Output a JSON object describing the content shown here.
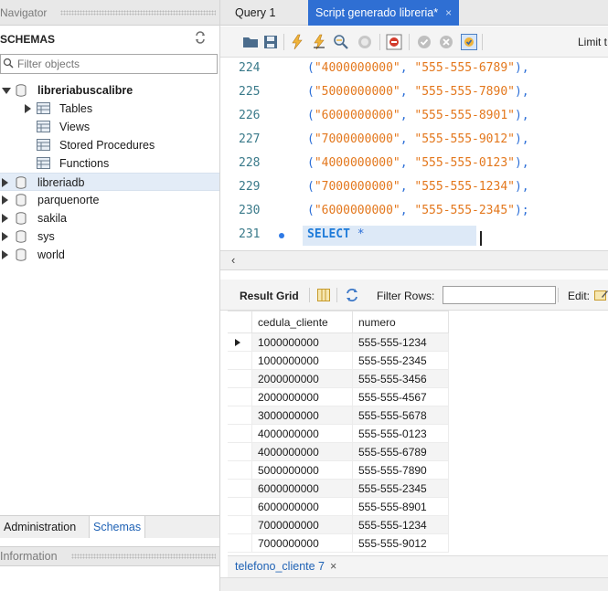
{
  "navigator": {
    "title": "Navigator",
    "schemas_label": "SCHEMAS",
    "filter_placeholder": "Filter objects",
    "tree": [
      {
        "label": "libreriabuscalibre",
        "expanded": true,
        "bold": true
      },
      {
        "label": "Tables"
      },
      {
        "label": "Views"
      },
      {
        "label": "Stored Procedures"
      },
      {
        "label": "Functions"
      },
      {
        "label": "libreriadb",
        "selected": true
      },
      {
        "label": "parquenorte"
      },
      {
        "label": "sakila"
      },
      {
        "label": "sys"
      },
      {
        "label": "world"
      }
    ],
    "bottom_tabs": [
      "Administration",
      "Schemas"
    ],
    "information_label": "Information"
  },
  "tabs": [
    {
      "label": "Query 1"
    },
    {
      "label": "Script generado libreria*",
      "active": true,
      "close": "×"
    }
  ],
  "toolbar": {
    "limit_label": "Limit t",
    "icons": [
      "open-folder-icon",
      "save-icon",
      "execute-icon",
      "execute-current-icon",
      "explain-icon",
      "stop-icon",
      "toggle-error-icon",
      "commit-icon",
      "rollback-icon",
      "autocommit-icon"
    ]
  },
  "editor": {
    "lines": [
      {
        "num": "224",
        "cedula": "\"4000000000\"",
        "numero": "\"555-555-6789\"",
        "end": "),"
      },
      {
        "num": "225",
        "cedula": "\"5000000000\"",
        "numero": "\"555-555-7890\"",
        "end": "),"
      },
      {
        "num": "226",
        "cedula": "\"6000000000\"",
        "numero": "\"555-555-8901\"",
        "end": "),"
      },
      {
        "num": "227",
        "cedula": "\"7000000000\"",
        "numero": "\"555-555-9012\"",
        "end": "),"
      },
      {
        "num": "228",
        "cedula": "\"4000000000\"",
        "numero": "\"555-555-0123\"",
        "end": "),"
      },
      {
        "num": "229",
        "cedula": "\"7000000000\"",
        "numero": "\"555-555-1234\"",
        "end": "),"
      },
      {
        "num": "230",
        "cedula": "\"6000000000\"",
        "numero": "\"555-555-2345\"",
        "end": ");"
      }
    ],
    "current_line": {
      "num": "231",
      "keyword": "SELECT",
      "rest": " *"
    }
  },
  "results": {
    "toolbar": {
      "result_grid": "Result Grid",
      "filter_rows": "Filter Rows:",
      "edit": "Edit:"
    },
    "columns": [
      "cedula_cliente",
      "numero"
    ],
    "rows": [
      [
        "1000000000",
        "555-555-1234"
      ],
      [
        "1000000000",
        "555-555-2345"
      ],
      [
        "2000000000",
        "555-555-3456"
      ],
      [
        "2000000000",
        "555-555-4567"
      ],
      [
        "3000000000",
        "555-555-5678"
      ],
      [
        "4000000000",
        "555-555-0123"
      ],
      [
        "4000000000",
        "555-555-6789"
      ],
      [
        "5000000000",
        "555-555-7890"
      ],
      [
        "6000000000",
        "555-555-2345"
      ],
      [
        "6000000000",
        "555-555-8901"
      ],
      [
        "7000000000",
        "555-555-1234"
      ],
      [
        "7000000000",
        "555-555-9012"
      ]
    ],
    "tab": {
      "label": "telefono_cliente 7",
      "close": "×"
    }
  },
  "colors": {
    "accent": "#2f6fd3",
    "string": "#e3771c",
    "keyword": "#1e7bd9"
  }
}
